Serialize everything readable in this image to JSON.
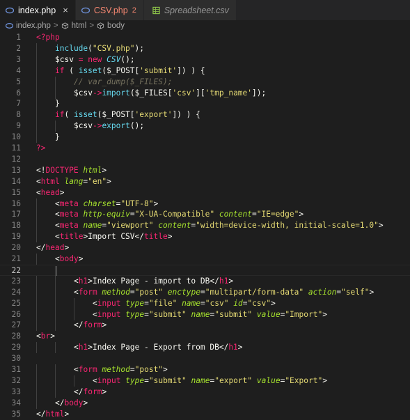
{
  "tabs": [
    {
      "label": "index.php",
      "close": "×",
      "active": true,
      "icon": "php-icon"
    },
    {
      "label": "CSV.php",
      "badge": "2",
      "error": true,
      "icon": "php-icon"
    },
    {
      "label": "Spreadsheet.csv",
      "italic": true,
      "icon": "spreadsheet-icon"
    }
  ],
  "breadcrumb": {
    "file": "index.php",
    "sep": ">",
    "items": [
      "html",
      "body"
    ]
  },
  "colors": {
    "tag": "#f92672",
    "attr": "#a6e22e",
    "string": "#e6db74",
    "function": "#66d9ef",
    "comment": "#75715e",
    "background": "#1e1e1e"
  },
  "current_line": 22,
  "lines": [
    {
      "n": "1",
      "indent": 0,
      "tokens": [
        [
          "t-tag",
          "<?php"
        ]
      ]
    },
    {
      "n": "2",
      "indent": 1,
      "tokens": [
        [
          "t-fn",
          "include"
        ],
        [
          "t-pl",
          "("
        ],
        [
          "t-str",
          "\"CSV.php\""
        ],
        [
          "t-pl",
          ");"
        ]
      ]
    },
    {
      "n": "3",
      "indent": 1,
      "tokens": [
        [
          "t-pl",
          "$csv "
        ],
        [
          "t-key",
          "="
        ],
        [
          "t-pl",
          " "
        ],
        [
          "t-key",
          "new"
        ],
        [
          "t-pl",
          " "
        ],
        [
          "t-fni",
          "CSV"
        ],
        [
          "t-pl",
          "();"
        ]
      ]
    },
    {
      "n": "4",
      "indent": 1,
      "tokens": [
        [
          "t-key",
          "if"
        ],
        [
          "t-pl",
          " ( "
        ],
        [
          "t-fn",
          "isset"
        ],
        [
          "t-pl",
          "($_POST["
        ],
        [
          "t-str",
          "'submit'"
        ],
        [
          "t-pl",
          "]) ) {"
        ]
      ]
    },
    {
      "n": "5",
      "indent": 2,
      "tokens": [
        [
          "t-cm",
          "// var_dump($_FILES);"
        ]
      ]
    },
    {
      "n": "6",
      "indent": 2,
      "tokens": [
        [
          "t-pl",
          "$csv"
        ],
        [
          "t-key",
          "->"
        ],
        [
          "t-fn",
          "import"
        ],
        [
          "t-pl",
          "($_FILES["
        ],
        [
          "t-str",
          "'csv'"
        ],
        [
          "t-pl",
          "]["
        ],
        [
          "t-str",
          "'tmp_name'"
        ],
        [
          "t-pl",
          "]);"
        ]
      ]
    },
    {
      "n": "7",
      "indent": 1,
      "tokens": [
        [
          "t-pl",
          "}"
        ]
      ]
    },
    {
      "n": "8",
      "indent": 1,
      "tokens": [
        [
          "t-key",
          "if"
        ],
        [
          "t-pl",
          "( "
        ],
        [
          "t-fn",
          "isset"
        ],
        [
          "t-pl",
          "($_POST["
        ],
        [
          "t-str",
          "'export'"
        ],
        [
          "t-pl",
          "]) ) {"
        ]
      ]
    },
    {
      "n": "9",
      "indent": 2,
      "tokens": [
        [
          "t-pl",
          "$csv"
        ],
        [
          "t-key",
          "->"
        ],
        [
          "t-fn",
          "export"
        ],
        [
          "t-pl",
          "();"
        ]
      ]
    },
    {
      "n": "10",
      "indent": 1,
      "tokens": [
        [
          "t-pl",
          "}"
        ]
      ]
    },
    {
      "n": "11",
      "indent": 0,
      "tokens": [
        [
          "t-tag",
          "?>"
        ]
      ]
    },
    {
      "n": "12",
      "indent": 0,
      "tokens": []
    },
    {
      "n": "13",
      "indent": 0,
      "tokens": [
        [
          "t-pl",
          "<!"
        ],
        [
          "t-tag",
          "DOCTYPE"
        ],
        [
          "t-pl",
          " "
        ],
        [
          "t-attr",
          "html"
        ],
        [
          "t-pl",
          ">"
        ]
      ]
    },
    {
      "n": "14",
      "indent": 0,
      "tokens": [
        [
          "t-pl",
          "<"
        ],
        [
          "t-tag",
          "html"
        ],
        [
          "t-pl",
          " "
        ],
        [
          "t-attr",
          "lang"
        ],
        [
          "t-pl",
          "="
        ],
        [
          "t-str",
          "\"en\""
        ],
        [
          "t-pl",
          ">"
        ]
      ]
    },
    {
      "n": "15",
      "indent": 0,
      "tokens": [
        [
          "t-pl",
          "<"
        ],
        [
          "t-tag",
          "head"
        ],
        [
          "t-pl",
          ">"
        ]
      ]
    },
    {
      "n": "16",
      "indent": 1,
      "tokens": [
        [
          "t-pl",
          "<"
        ],
        [
          "t-tag",
          "meta"
        ],
        [
          "t-pl",
          " "
        ],
        [
          "t-attr",
          "charset"
        ],
        [
          "t-pl",
          "="
        ],
        [
          "t-str",
          "\"UTF-8\""
        ],
        [
          "t-pl",
          ">"
        ]
      ]
    },
    {
      "n": "17",
      "indent": 1,
      "tokens": [
        [
          "t-pl",
          "<"
        ],
        [
          "t-tag",
          "meta"
        ],
        [
          "t-pl",
          " "
        ],
        [
          "t-attr",
          "http-equiv"
        ],
        [
          "t-pl",
          "="
        ],
        [
          "t-str",
          "\"X-UA-Compatible\""
        ],
        [
          "t-pl",
          " "
        ],
        [
          "t-attr",
          "content"
        ],
        [
          "t-pl",
          "="
        ],
        [
          "t-str",
          "\"IE=edge\""
        ],
        [
          "t-pl",
          ">"
        ]
      ]
    },
    {
      "n": "18",
      "indent": 1,
      "tokens": [
        [
          "t-pl",
          "<"
        ],
        [
          "t-tag",
          "meta"
        ],
        [
          "t-pl",
          " "
        ],
        [
          "t-attr",
          "name"
        ],
        [
          "t-pl",
          "="
        ],
        [
          "t-str",
          "\"viewport\""
        ],
        [
          "t-pl",
          " "
        ],
        [
          "t-attr",
          "content"
        ],
        [
          "t-pl",
          "="
        ],
        [
          "t-str",
          "\"width=device-width, initial-scale=1.0\""
        ],
        [
          "t-pl",
          ">"
        ]
      ]
    },
    {
      "n": "19",
      "indent": 1,
      "tokens": [
        [
          "t-pl",
          "<"
        ],
        [
          "t-tag",
          "title"
        ],
        [
          "t-pl",
          ">Import CSV</"
        ],
        [
          "t-tag",
          "title"
        ],
        [
          "t-pl",
          ">"
        ]
      ]
    },
    {
      "n": "20",
      "indent": 0,
      "tokens": [
        [
          "t-pl",
          "</"
        ],
        [
          "t-tag",
          "head"
        ],
        [
          "t-pl",
          ">"
        ]
      ]
    },
    {
      "n": "21",
      "indent": 1,
      "tokens": [
        [
          "t-pl",
          "<"
        ],
        [
          "t-tag",
          "body"
        ],
        [
          "t-pl",
          ">"
        ]
      ]
    },
    {
      "n": "22",
      "indent": 0,
      "tokens": []
    },
    {
      "n": "23",
      "indent": 2,
      "tokens": [
        [
          "t-pl",
          "<"
        ],
        [
          "t-tag",
          "h1"
        ],
        [
          "t-pl",
          ">Index Page - import to DB</"
        ],
        [
          "t-tag",
          "h1"
        ],
        [
          "t-pl",
          ">"
        ]
      ]
    },
    {
      "n": "24",
      "indent": 2,
      "tokens": [
        [
          "t-pl",
          "<"
        ],
        [
          "t-tag",
          "form"
        ],
        [
          "t-pl",
          " "
        ],
        [
          "t-attr",
          "method"
        ],
        [
          "t-pl",
          "="
        ],
        [
          "t-str",
          "\"post\""
        ],
        [
          "t-pl",
          " "
        ],
        [
          "t-attr",
          "enctype"
        ],
        [
          "t-pl",
          "="
        ],
        [
          "t-str",
          "\"multipart/form-data\""
        ],
        [
          "t-pl",
          " "
        ],
        [
          "t-attr",
          "action"
        ],
        [
          "t-pl",
          "="
        ],
        [
          "t-str",
          "\"self\""
        ],
        [
          "t-pl",
          ">"
        ]
      ]
    },
    {
      "n": "25",
      "indent": 3,
      "tokens": [
        [
          "t-pl",
          "<"
        ],
        [
          "t-tag",
          "input"
        ],
        [
          "t-pl",
          " "
        ],
        [
          "t-attr",
          "type"
        ],
        [
          "t-pl",
          "="
        ],
        [
          "t-str",
          "\"file\""
        ],
        [
          "t-pl",
          " "
        ],
        [
          "t-attr",
          "name"
        ],
        [
          "t-pl",
          "="
        ],
        [
          "t-str",
          "\"csv\""
        ],
        [
          "t-pl",
          " "
        ],
        [
          "t-attr",
          "id"
        ],
        [
          "t-pl",
          "="
        ],
        [
          "t-str",
          "\"csv\""
        ],
        [
          "t-pl",
          ">"
        ]
      ]
    },
    {
      "n": "26",
      "indent": 3,
      "tokens": [
        [
          "t-pl",
          "<"
        ],
        [
          "t-tag",
          "input"
        ],
        [
          "t-pl",
          " "
        ],
        [
          "t-attr",
          "type"
        ],
        [
          "t-pl",
          "="
        ],
        [
          "t-str",
          "\"submit\""
        ],
        [
          "t-pl",
          " "
        ],
        [
          "t-attr",
          "name"
        ],
        [
          "t-pl",
          "="
        ],
        [
          "t-str",
          "\"submit\""
        ],
        [
          "t-pl",
          " "
        ],
        [
          "t-attr",
          "value"
        ],
        [
          "t-pl",
          "="
        ],
        [
          "t-str",
          "\"Import\""
        ],
        [
          "t-pl",
          ">"
        ]
      ]
    },
    {
      "n": "27",
      "indent": 2,
      "tokens": [
        [
          "t-pl",
          "</"
        ],
        [
          "t-tag",
          "form"
        ],
        [
          "t-pl",
          ">"
        ]
      ]
    },
    {
      "n": "28",
      "indent": 0,
      "tokens": [
        [
          "t-pl",
          "<"
        ],
        [
          "t-tag",
          "br"
        ],
        [
          "t-pl",
          ">"
        ]
      ]
    },
    {
      "n": "29",
      "indent": 2,
      "tokens": [
        [
          "t-pl",
          "<"
        ],
        [
          "t-tag",
          "h1"
        ],
        [
          "t-pl",
          ">Index Page - Export from DB</"
        ],
        [
          "t-tag",
          "h1"
        ],
        [
          "t-pl",
          ">"
        ]
      ]
    },
    {
      "n": "30",
      "indent": 0,
      "tokens": []
    },
    {
      "n": "31",
      "indent": 2,
      "tokens": [
        [
          "t-pl",
          "<"
        ],
        [
          "t-tag",
          "form"
        ],
        [
          "t-pl",
          " "
        ],
        [
          "t-attr",
          "method"
        ],
        [
          "t-pl",
          "="
        ],
        [
          "t-str",
          "\"post\""
        ],
        [
          "t-pl",
          ">"
        ]
      ]
    },
    {
      "n": "32",
      "indent": 3,
      "tokens": [
        [
          "t-pl",
          "<"
        ],
        [
          "t-tag",
          "input"
        ],
        [
          "t-pl",
          " "
        ],
        [
          "t-attr",
          "type"
        ],
        [
          "t-pl",
          "="
        ],
        [
          "t-str",
          "\"submit\""
        ],
        [
          "t-pl",
          " "
        ],
        [
          "t-attr",
          "name"
        ],
        [
          "t-pl",
          "="
        ],
        [
          "t-str",
          "\"export\""
        ],
        [
          "t-pl",
          " "
        ],
        [
          "t-attr",
          "value"
        ],
        [
          "t-pl",
          "="
        ],
        [
          "t-str",
          "\"Export\""
        ],
        [
          "t-pl",
          ">"
        ]
      ]
    },
    {
      "n": "33",
      "indent": 2,
      "tokens": [
        [
          "t-pl",
          "</"
        ],
        [
          "t-tag",
          "form"
        ],
        [
          "t-pl",
          ">"
        ]
      ]
    },
    {
      "n": "34",
      "indent": 1,
      "tokens": [
        [
          "t-pl",
          "</"
        ],
        [
          "t-tag",
          "body"
        ],
        [
          "t-pl",
          ">"
        ]
      ]
    },
    {
      "n": "35",
      "indent": 0,
      "tokens": [
        [
          "t-pl",
          "</"
        ],
        [
          "t-tag",
          "html"
        ],
        [
          "t-pl",
          ">"
        ]
      ]
    }
  ]
}
